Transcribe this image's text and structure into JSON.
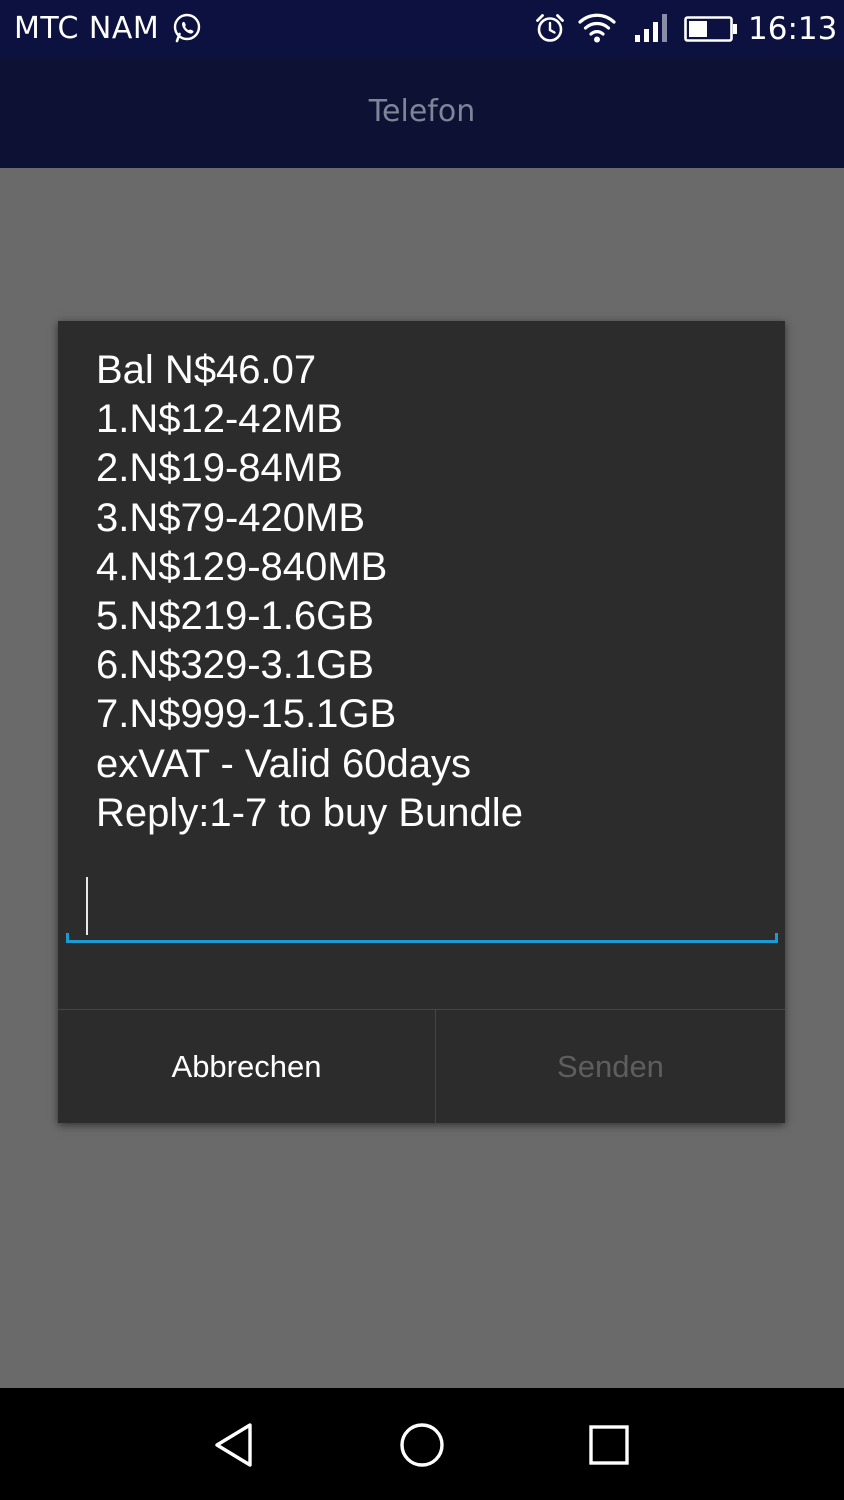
{
  "status_bar": {
    "carrier": "MTC NAM",
    "time": "16:13",
    "icons": [
      "whatsapp-icon",
      "alarm-icon",
      "wifi-icon",
      "signal-icon",
      "battery-icon"
    ]
  },
  "app_bar": {
    "title": "Telefon"
  },
  "dialog": {
    "message_lines": [
      "Bal N$46.07",
      "1.N$12-42MB",
      "2.N$19-84MB",
      "3.N$79-420MB",
      "4.N$129-840MB",
      "5.N$219-1.6GB",
      "6.N$329-3.1GB",
      "7.N$999-15.1GB",
      "exVAT - Valid 60days",
      "Reply:1-7 to buy Bundle"
    ],
    "reply_input": {
      "value": "",
      "placeholder": ""
    },
    "cancel_label": "Abbrechen",
    "send_label": "Senden"
  },
  "colors": {
    "status_bar_bg": "#0d1140",
    "dialog_bg": "#2c2c2c",
    "accent": "#1a9bd1",
    "disabled_text": "#5e5e5e"
  },
  "nav_bar": {
    "icons": [
      "back-icon",
      "home-icon",
      "recent-apps-icon"
    ]
  }
}
